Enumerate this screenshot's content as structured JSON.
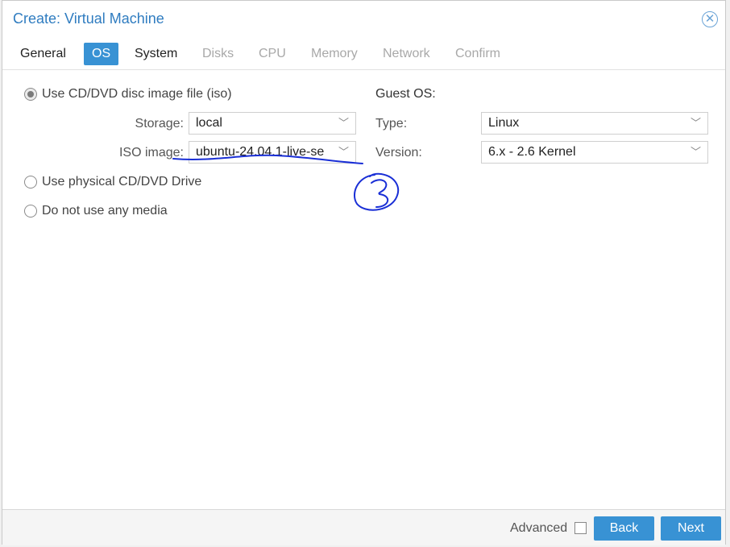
{
  "dialog": {
    "title": "Create: Virtual Machine",
    "close_icon": "close-circle-icon"
  },
  "tabs": [
    {
      "label": "General",
      "state": "normal"
    },
    {
      "label": "OS",
      "state": "active"
    },
    {
      "label": "System",
      "state": "normal"
    },
    {
      "label": "Disks",
      "state": "disabled"
    },
    {
      "label": "CPU",
      "state": "disabled"
    },
    {
      "label": "Memory",
      "state": "disabled"
    },
    {
      "label": "Network",
      "state": "disabled"
    },
    {
      "label": "Confirm",
      "state": "disabled"
    }
  ],
  "media": {
    "iso_option": "Use CD/DVD disc image file (iso)",
    "iso_selected": true,
    "storage_label": "Storage:",
    "storage_value": "local",
    "iso_label": "ISO image:",
    "iso_value": "ubuntu-24.04.1-live-se",
    "physical_option": "Use physical CD/DVD Drive",
    "none_option": "Do not use any media"
  },
  "guest_os": {
    "heading": "Guest OS:",
    "type_label": "Type:",
    "type_value": "Linux",
    "version_label": "Version:",
    "version_value": "6.x - 2.6 Kernel"
  },
  "footer": {
    "advanced_label": "Advanced",
    "advanced_checked": false,
    "back_label": "Back",
    "next_label": "Next"
  },
  "colors": {
    "accent": "#3892d4",
    "title": "#2f7cc0",
    "annotation_ink": "#1a2fd6"
  }
}
